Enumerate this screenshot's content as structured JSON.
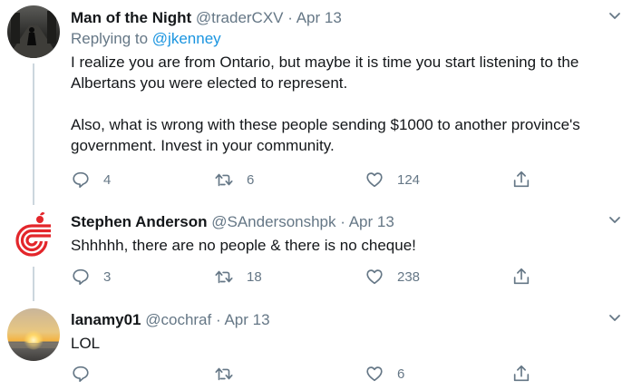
{
  "tweets": [
    {
      "name": "Man of the Night",
      "handle": "@traderCXV",
      "date": "Apr 13",
      "reply_prefix": "Replying to",
      "reply_mention": "@jkenney",
      "paragraphs": [
        "I realize you are from Ontario, but maybe it is time you start listening to the Albertans you were elected to represent.",
        "Also, what is wrong with these people sending $1000 to another province's government. Invest in your community."
      ],
      "replies": "4",
      "retweets": "6",
      "likes": "124"
    },
    {
      "name": "Stephen Anderson",
      "handle": "@SAndersonshpk",
      "date": "Apr 13",
      "paragraphs": [
        "Shhhhh, there are no people & there is no cheque!"
      ],
      "replies": "3",
      "retweets": "18",
      "likes": "238"
    },
    {
      "name": "lanamy01",
      "handle": "@cochraf",
      "date": "Apr 13",
      "paragraphs": [
        "LOL"
      ],
      "replies": "",
      "retweets": "",
      "likes": "6"
    }
  ],
  "separator": "·",
  "colors": {
    "text": "#14171a",
    "secondary": "#657786",
    "link": "#1b95e0",
    "thread_line": "#ccd6dd",
    "avatar_logo_red": "#e3262b"
  },
  "icons": [
    "reply-icon",
    "retweet-icon",
    "like-icon",
    "share-icon",
    "chevron-down-icon"
  ]
}
